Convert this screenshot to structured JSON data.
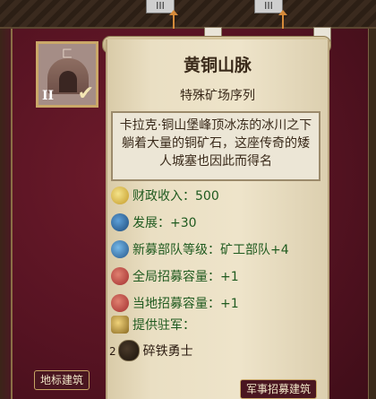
{
  "tooltip": {
    "title": "黄铜山脉",
    "subtitle": "特殊矿场序列",
    "description": "卡拉克·铜山堡峰顶冰冻的冰川之下躺着大量的铜矿石，这座传奇的矮人城塞也因此而得名",
    "effects": [
      {
        "icon": "coin-icon",
        "text": "财政收入：500"
      },
      {
        "icon": "development-icon",
        "text": "发展：+30"
      },
      {
        "icon": "recruit-level-icon",
        "text": "新募部队等级：矿工部队+4"
      },
      {
        "icon": "global-recruit-icon",
        "text": "全局招募容量：+1"
      },
      {
        "icon": "local-recruit-icon",
        "text": "当地招募容量：+1"
      },
      {
        "icon": "garrison-icon",
        "text": "提供驻军："
      }
    ],
    "garrison_unit": {
      "count": "2",
      "name": "碎铁勇士"
    }
  },
  "building_card": {
    "tier": "II",
    "corner_glyph": "匚"
  },
  "top_slots": [
    "III",
    "III"
  ],
  "bottom_buttons": {
    "left": "地标建筑",
    "right": "军事招募建筑"
  },
  "colors": {
    "effect_text": "#1f5a1f",
    "title_text": "#3a2a1a",
    "background": "#561322"
  }
}
